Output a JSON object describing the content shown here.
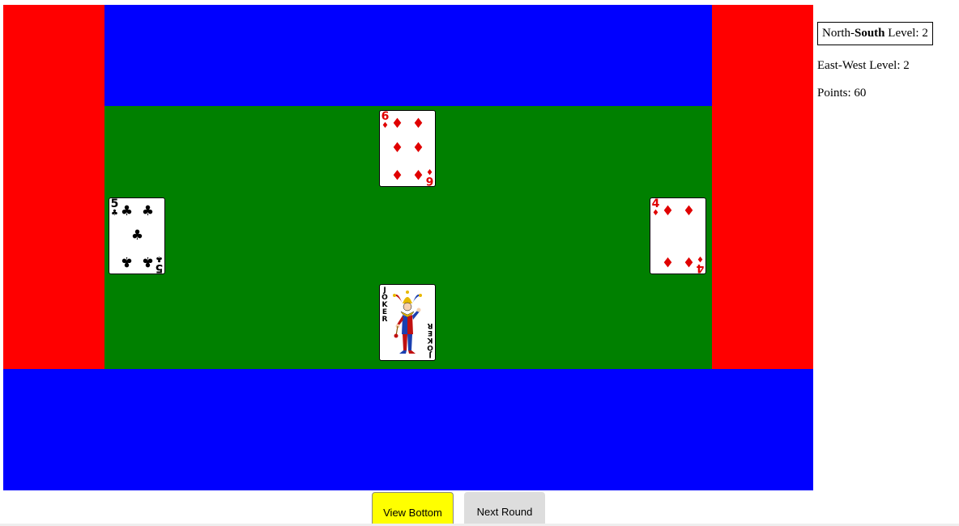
{
  "colors": {
    "ew_zone": "#ff0000",
    "ns_zone": "#0000ff",
    "table": "#008000",
    "view_bottom_button": "#ffff00",
    "next_round_button": "#dddddd"
  },
  "table": {
    "north_card": {
      "rank": "6",
      "suit": "♦",
      "suit_name": "diamonds",
      "color": "red"
    },
    "west_card": {
      "rank": "5",
      "suit": "♣",
      "suit_name": "clubs",
      "color": "black"
    },
    "east_card": {
      "rank": "4",
      "suit": "♦",
      "suit_name": "diamonds",
      "color": "red"
    },
    "south_card": {
      "rank": "JOKER",
      "suit_name": "joker",
      "icon": "jester-icon"
    }
  },
  "sidebar": {
    "ns_prefix": "North-",
    "ns_bold": "South",
    "ns_level_label": " Level: ",
    "ns_level": "2",
    "ew_level_text": "East-West Level: 2",
    "points_text": "Points: 60"
  },
  "buttons": {
    "view_bottom": "View Bottom",
    "next_round": "Next Round"
  }
}
